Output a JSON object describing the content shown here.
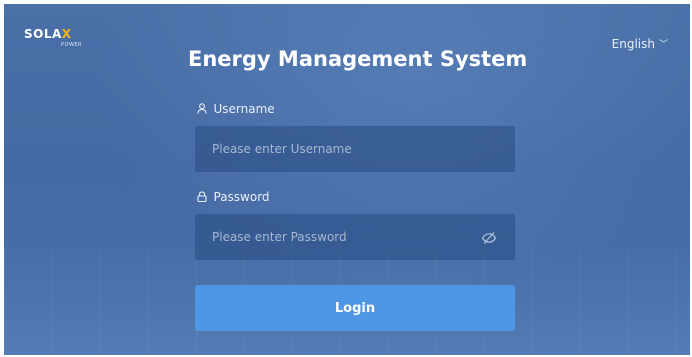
{
  "brand": {
    "logo_main": "SOLA",
    "logo_x": "X",
    "logo_sub": "POWER"
  },
  "language": {
    "selected": "English",
    "chevron": "﹀"
  },
  "page": {
    "title": "Energy Management System"
  },
  "form": {
    "username": {
      "label": "Username",
      "icon": "person-icon",
      "placeholder": "Please enter Username"
    },
    "password": {
      "label": "Password",
      "icon": "lock-icon",
      "placeholder": "Please enter Password",
      "toggle_icon": "eye-slash-icon"
    },
    "login_label": "Login"
  },
  "colors": {
    "background": "#4a70a8",
    "accent": "#4f96e5",
    "logo_x": "#f5b21b"
  }
}
